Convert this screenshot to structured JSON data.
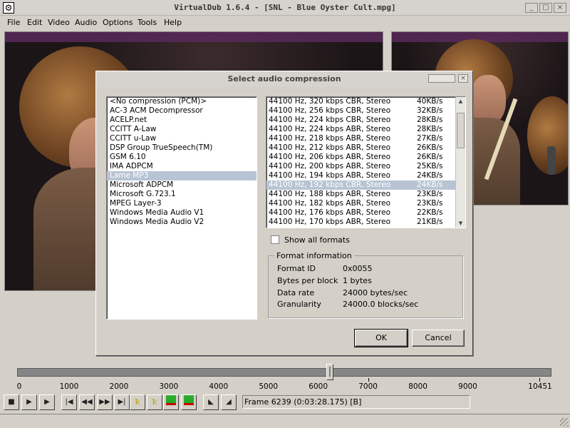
{
  "window": {
    "title": "VirtualDub 1.6.4 - [SNL - Blue Oyster Cult.mpg]",
    "min_btn": "_",
    "max_btn": "□",
    "close_btn": "×"
  },
  "menu": [
    "File",
    "Edit",
    "Video",
    "Audio",
    "Options",
    "Tools",
    "Help"
  ],
  "dialog": {
    "title": "Select audio compression",
    "codecs": [
      "<No compression (PCM)>",
      "AC-3 ACM Decompressor",
      "ACELP.net",
      "CCITT A-Law",
      "CCITT u-Law",
      "DSP Group TrueSpeech(TM)",
      "GSM 6.10",
      "IMA ADPCM",
      "Lame MP3",
      "Microsoft ADPCM",
      "Microsoft G.723.1",
      "MPEG Layer-3",
      "Windows Media Audio V1",
      "Windows Media Audio V2"
    ],
    "selected_codec_index": 8,
    "formats": [
      {
        "name": "44100 Hz, 320 kbps CBR, Stereo",
        "rate": "40KB/s"
      },
      {
        "name": "44100 Hz, 256 kbps CBR, Stereo",
        "rate": "32KB/s"
      },
      {
        "name": "44100 Hz, 224 kbps CBR, Stereo",
        "rate": "28KB/s"
      },
      {
        "name": "44100 Hz, 224 kbps ABR, Stereo",
        "rate": "28KB/s"
      },
      {
        "name": "44100 Hz, 218 kbps ABR, Stereo",
        "rate": "27KB/s"
      },
      {
        "name": "44100 Hz, 212 kbps ABR, Stereo",
        "rate": "26KB/s"
      },
      {
        "name": "44100 Hz, 206 kbps ABR, Stereo",
        "rate": "26KB/s"
      },
      {
        "name": "44100 Hz, 200 kbps ABR, Stereo",
        "rate": "25KB/s"
      },
      {
        "name": "44100 Hz, 194 kbps ABR, Stereo",
        "rate": "24KB/s"
      },
      {
        "name": "44100 Hz, 192 kbps CBR, Stereo",
        "rate": "24KB/s"
      },
      {
        "name": "44100 Hz, 188 kbps ABR, Stereo",
        "rate": "23KB/s"
      },
      {
        "name": "44100 Hz, 182 kbps ABR, Stereo",
        "rate": "23KB/s"
      },
      {
        "name": "44100 Hz, 176 kbps ABR, Stereo",
        "rate": "22KB/s"
      },
      {
        "name": "44100 Hz, 170 kbps ABR, Stereo",
        "rate": "21KB/s"
      }
    ],
    "selected_format_index": 9,
    "show_all_label": "Show all formats",
    "show_all_checked": false,
    "format_info": {
      "title": "Format information",
      "rows": [
        {
          "key": "Format ID",
          "value": "0x0055"
        },
        {
          "key": "Bytes per block",
          "value": "1 bytes"
        },
        {
          "key": "Data rate",
          "value": "24000 bytes/sec"
        },
        {
          "key": "Granularity",
          "value": "24000.0 blocks/sec"
        }
      ]
    },
    "ok_label": "OK",
    "cancel_label": "Cancel"
  },
  "timeline": {
    "ticks": [
      "0",
      "1000",
      "2000",
      "3000",
      "4000",
      "5000",
      "6000",
      "7000",
      "8000",
      "9000",
      "10451"
    ],
    "tick_values": [
      0,
      1000,
      2000,
      3000,
      4000,
      5000,
      6000,
      7000,
      8000,
      9000,
      10451
    ],
    "max_frame": 10451,
    "current_frame": 6239
  },
  "toolbar": {
    "status": "Frame 6239 (0:03:28.175) [B]",
    "icons": [
      "stop-icon",
      "play-input-icon",
      "play-output-icon",
      "go-start-icon",
      "prev-frame-icon",
      "next-frame-icon",
      "go-end-icon",
      "prev-key-icon",
      "next-key-icon",
      "prev-scene-icon",
      "next-scene-icon",
      "mark-in-icon",
      "mark-out-icon"
    ]
  }
}
